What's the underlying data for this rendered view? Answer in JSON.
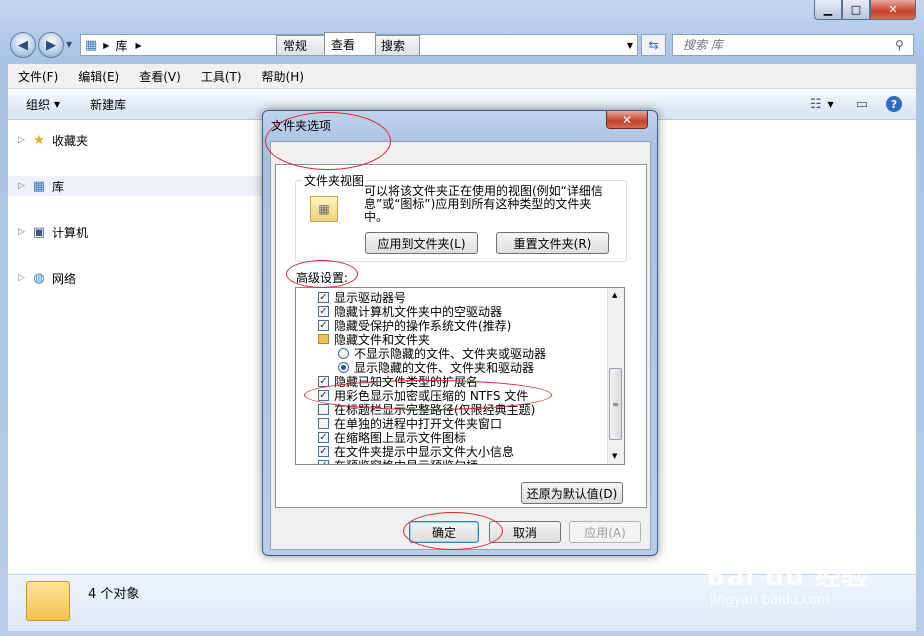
{
  "explorer": {
    "address": {
      "crumb": "库"
    },
    "search": {
      "placeholder": "搜索 库"
    },
    "menu": [
      "文件(F)",
      "编辑(E)",
      "查看(V)",
      "工具(T)",
      "帮助(H)"
    ],
    "toolbar": {
      "organize": "组织",
      "new_library": "新建库"
    },
    "nav": {
      "favorites": "收藏夹",
      "libraries": "库",
      "computer": "计算机",
      "network": "网络"
    },
    "status": {
      "count": "4 个对象"
    }
  },
  "dialog": {
    "title": "文件夹选项",
    "tabs": [
      "常规",
      "查看",
      "搜索"
    ],
    "folder_view": {
      "group_label": "文件夹视图",
      "description": "可以将该文件夹正在使用的视图(例如“详细信息”或“图标”)应用到所有这种类型的文件夹中。",
      "apply_button": "应用到文件夹(L)",
      "reset_button": "重置文件夹(R)"
    },
    "advanced": {
      "label": "高级设置:",
      "items": [
        {
          "type": "checkbox",
          "checked": true,
          "label": "显示驱动器号"
        },
        {
          "type": "checkbox",
          "checked": true,
          "label": "隐藏计算机文件夹中的空驱动器"
        },
        {
          "type": "checkbox",
          "checked": true,
          "label": "隐藏受保护的操作系统文件(推荐)"
        },
        {
          "type": "folder",
          "label": "隐藏文件和文件夹"
        },
        {
          "type": "radio",
          "checked": false,
          "label": "不显示隐藏的文件、文件夹或驱动器"
        },
        {
          "type": "radio",
          "checked": true,
          "label": "显示隐藏的文件、文件夹和驱动器"
        },
        {
          "type": "checkbox",
          "checked": true,
          "label": "隐藏已知文件类型的扩展名"
        },
        {
          "type": "checkbox",
          "checked": true,
          "label": "用彩色显示加密或压缩的 NTFS 文件"
        },
        {
          "type": "checkbox",
          "checked": false,
          "label": "在标题栏显示完整路径(仅限经典主题)"
        },
        {
          "type": "checkbox",
          "checked": false,
          "label": "在单独的进程中打开文件夹窗口"
        },
        {
          "type": "checkbox",
          "checked": true,
          "label": "在缩略图上显示文件图标"
        },
        {
          "type": "checkbox",
          "checked": true,
          "label": "在文件夹提示中显示文件大小信息"
        },
        {
          "type": "checkbox",
          "checked": true,
          "label": "在预览窗格中显示预览句柄"
        }
      ],
      "restore_button": "还原为默认值(D)"
    },
    "ok": "确定",
    "cancel": "取消",
    "apply": "应用(A)"
  },
  "watermark": {
    "brand": "Bai du 经验",
    "url": "jingyan.baidu.com"
  }
}
